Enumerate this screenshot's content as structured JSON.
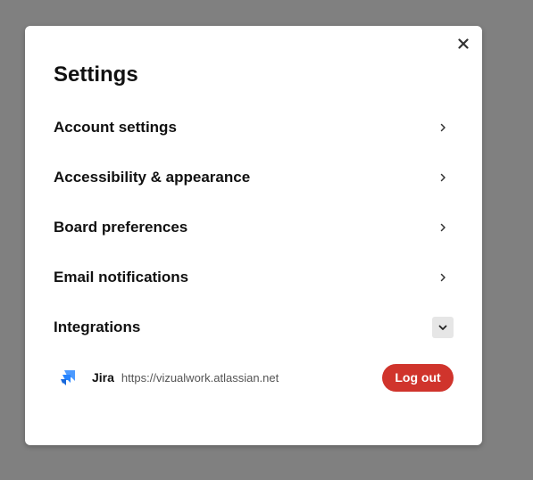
{
  "settings": {
    "title": "Settings",
    "close_icon": "close-icon",
    "items": [
      {
        "label": "Account settings",
        "icon": "chevron-right-icon"
      },
      {
        "label": "Accessibility & appearance",
        "icon": "chevron-right-icon"
      },
      {
        "label": "Board preferences",
        "icon": "chevron-right-icon"
      },
      {
        "label": "Email notifications",
        "icon": "chevron-right-icon"
      },
      {
        "label": "Integrations",
        "icon": "chevron-down-icon",
        "expanded": true
      }
    ],
    "integrations": [
      {
        "name": "Jira",
        "url": "https://vizualwork.atlassian.net",
        "icon": "jira-logo-icon",
        "action_label": "Log out"
      }
    ]
  },
  "colors": {
    "overlay": "#808080",
    "modal_background": "#ffffff",
    "logout_button": "#d0342c",
    "jira_blue_dark": "#1868db",
    "jira_blue_light": "#4c9aff",
    "expand_button_background": "#e6e6e6"
  }
}
